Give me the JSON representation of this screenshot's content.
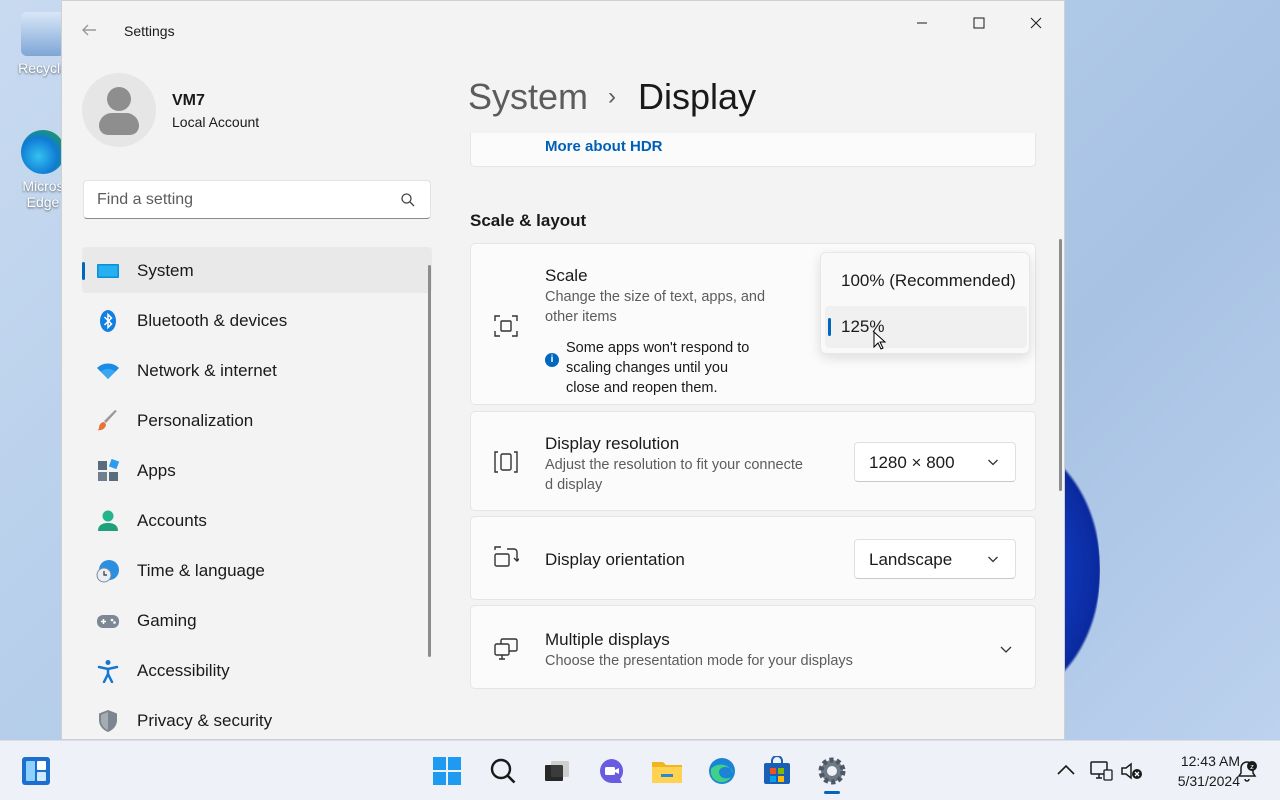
{
  "desktop": {
    "icons": [
      {
        "label": "Recycle"
      },
      {
        "label": "Micros Edge"
      }
    ]
  },
  "window": {
    "title": "Settings"
  },
  "profile": {
    "name": "VM7",
    "account_type": "Local Account"
  },
  "search": {
    "placeholder": "Find a setting"
  },
  "sidebar": {
    "items": [
      {
        "label": "System",
        "icon": "system-icon",
        "selected": true
      },
      {
        "label": "Bluetooth & devices",
        "icon": "bluetooth-icon"
      },
      {
        "label": "Network & internet",
        "icon": "wifi-icon"
      },
      {
        "label": "Personalization",
        "icon": "brush-icon"
      },
      {
        "label": "Apps",
        "icon": "apps-icon"
      },
      {
        "label": "Accounts",
        "icon": "accounts-icon"
      },
      {
        "label": "Time & language",
        "icon": "time-language-icon"
      },
      {
        "label": "Gaming",
        "icon": "gamepad-icon"
      },
      {
        "label": "Accessibility",
        "icon": "accessibility-icon"
      },
      {
        "label": "Privacy & security",
        "icon": "shield-icon"
      }
    ]
  },
  "breadcrumb": {
    "parent": "System",
    "separator": "›",
    "current": "Display"
  },
  "hdr": {
    "link": "More about HDR"
  },
  "scale_layout": {
    "section_title": "Scale & layout",
    "scale": {
      "title": "Scale",
      "subtitle_line1": "Change the size of text, apps, and",
      "subtitle_line2": "other items",
      "note_line1": "Some apps won't respond to",
      "note_line2": "scaling changes until you",
      "note_line3": "close and reopen them.",
      "options": [
        {
          "label": "100% (Recommended)",
          "selected": false
        },
        {
          "label": "125%",
          "selected": true
        }
      ]
    },
    "resolution": {
      "title": "Display resolution",
      "subtitle_line1": "Adjust the resolution to fit your connecte",
      "subtitle_line2": "d display",
      "value": "1280 × 800"
    },
    "orientation": {
      "title": "Display orientation",
      "value": "Landscape"
    },
    "multiple": {
      "title": "Multiple displays",
      "subtitle": "Choose the presentation mode for your displays"
    }
  },
  "taskbar": {
    "time": "12:43 AM",
    "date": "5/31/2024",
    "apps": [
      "widgets-icon",
      "start-icon",
      "search-icon",
      "task-view-icon",
      "chat-icon",
      "file-explorer-icon",
      "edge-icon",
      "store-icon",
      "settings-icon"
    ]
  },
  "colors": {
    "accent": "#0067c0",
    "link": "#005fb8"
  }
}
